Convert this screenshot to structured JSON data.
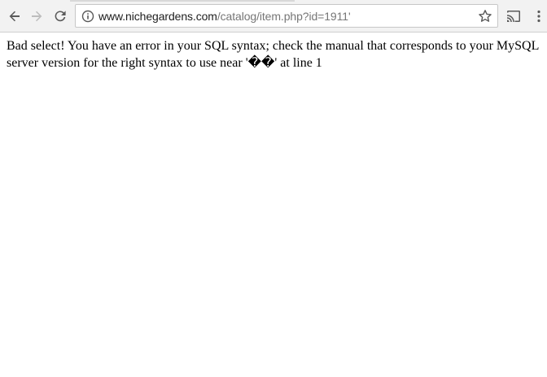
{
  "browser": {
    "url_host": "www.nichegardens.com",
    "url_path": "/catalog/item.php?id=1911'",
    "icons": {
      "back": "back-arrow-icon",
      "forward": "forward-arrow-icon",
      "reload": "reload-icon",
      "site_info": "info-icon",
      "bookmark": "star-icon",
      "cast": "cast-icon",
      "menu": "menu-dots-icon"
    },
    "colors": {
      "toolbar_bg": "#f2f2f2",
      "url_host": "#202020",
      "url_path": "#767676",
      "icon": "#5a5a5a",
      "icon_disabled": "#bdbdbd"
    }
  },
  "page": {
    "error_message": "Bad select! You have an error in your SQL syntax; check the manual that corresponds to your MySQL server version for the right syntax to use near '��' at line 1"
  }
}
